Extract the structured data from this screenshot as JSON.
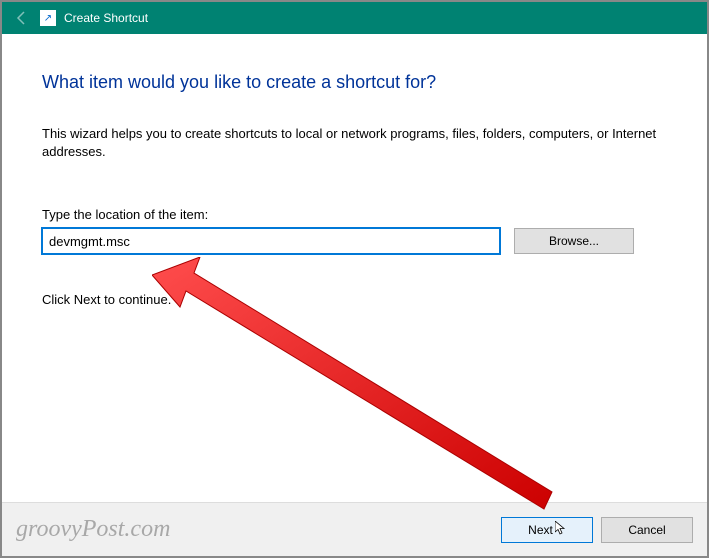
{
  "titlebar": {
    "title": "Create Shortcut"
  },
  "content": {
    "heading": "What item would you like to create a shortcut for?",
    "description": "This wizard helps you to create shortcuts to local or network programs, files, folders, computers, or Internet addresses.",
    "field_label": "Type the location of the item:",
    "input_value": "devmgmt.msc",
    "browse_label": "Browse...",
    "continue_text": "Click Next to continue."
  },
  "bottombar": {
    "next_label": "Next",
    "cancel_label": "Cancel"
  },
  "watermark": "groovyPost.com"
}
